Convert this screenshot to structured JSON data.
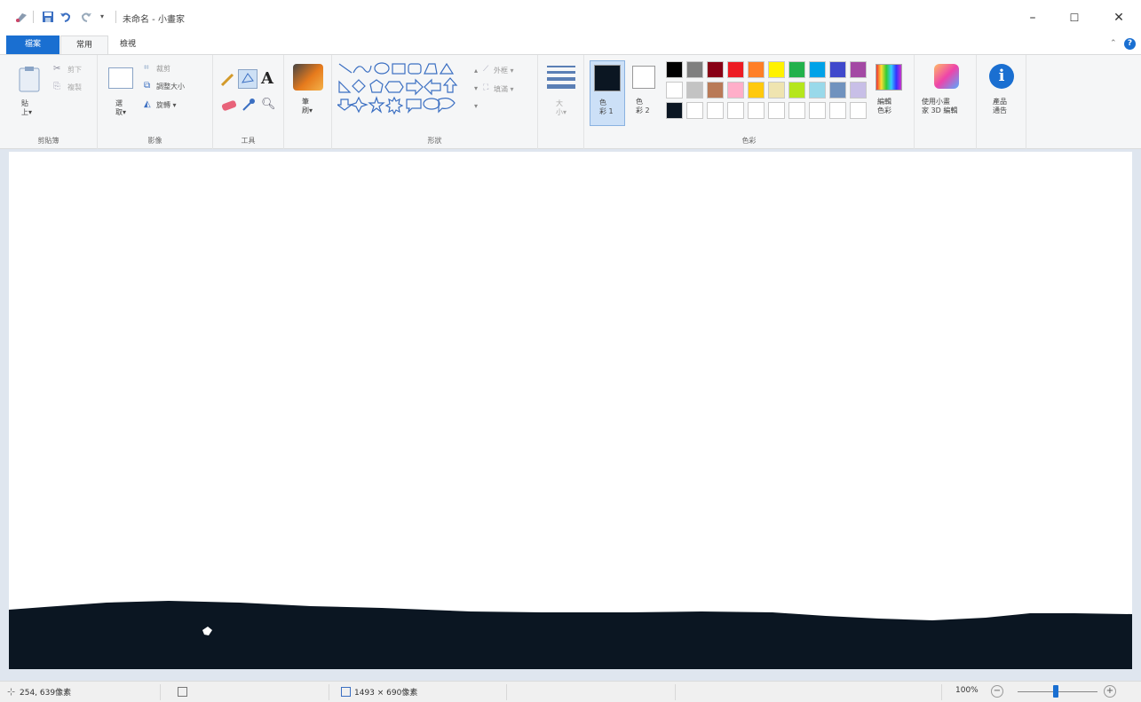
{
  "title_bar": {
    "title": "未命名 - 小畫家",
    "minimize": "–",
    "maximize": "☐",
    "close": "✕"
  },
  "tabs": {
    "file": "檔案",
    "home": "常用",
    "view": "檢視"
  },
  "ribbon": {
    "clipboard": {
      "paste": "貼\n上▾",
      "cut": "剪下",
      "copy": "複製",
      "group": "剪貼簿"
    },
    "image": {
      "select": "選\n取▾",
      "crop": "裁剪",
      "resize": "調整大小",
      "rotate": "旋轉 ▾",
      "group": "影像"
    },
    "tools": {
      "group": "工具"
    },
    "brushes": {
      "label": "筆\n刷▾"
    },
    "shapes": {
      "outline": "外框 ▾",
      "fill": "填滿 ▾",
      "group": "形狀"
    },
    "size": {
      "label": "大\n小▾"
    },
    "colors": {
      "color1": "色\n彩 1",
      "color2": "色\n彩 2",
      "edit": "編輯\n色彩",
      "group": "色彩",
      "color1_value": "#0b1622",
      "color2_value": "#ffffff",
      "palette_row1": [
        "#000000",
        "#7f7f7f",
        "#880015",
        "#ed1c24",
        "#ff7f27",
        "#fff200",
        "#22b14c",
        "#00a2e8",
        "#3f48cc",
        "#a349a4"
      ],
      "palette_row2": [
        "#ffffff",
        "#c3c3c3",
        "#b97a57",
        "#ffaec9",
        "#ffc90e",
        "#efe4b0",
        "#b5e61d",
        "#99d9ea",
        "#7092be",
        "#c8bfe7"
      ],
      "palette_row3": [
        "#0b1622",
        "#ffffff",
        "#ffffff",
        "#ffffff",
        "#ffffff",
        "#ffffff",
        "#ffffff",
        "#ffffff",
        "#ffffff",
        "#ffffff"
      ]
    },
    "paint3d": {
      "label": "使用小畫\n家 3D 編輯"
    },
    "alert": {
      "label": "產品\n通告"
    }
  },
  "status": {
    "cursor_pos": "254, 639像素",
    "image_size": "1493 × 690像素",
    "zoom": "100%",
    "zoom_minus": "−",
    "zoom_plus": "+"
  },
  "canvas": {
    "ink_color": "#0b1622"
  }
}
